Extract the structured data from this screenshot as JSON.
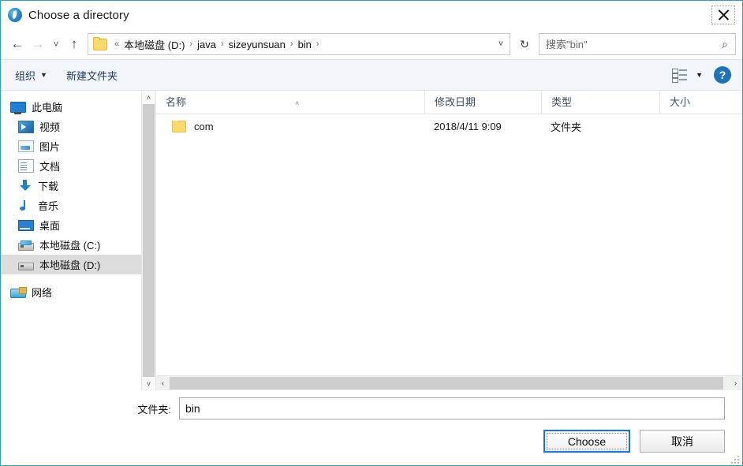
{
  "window": {
    "title": "Choose a directory",
    "title_icon": "app-globe-icon",
    "close_label": "✕",
    "border_color": "#2f9fc4"
  },
  "nav": {
    "back_icon": "←",
    "forward_icon": "→",
    "recent_icon": "˅",
    "up_icon": "↑",
    "refresh_icon": "↻",
    "dropdown_icon": "˅",
    "breadcrumb_prefix": "«",
    "breadcrumbs": [
      "本地磁盘 (D:)",
      "java",
      "sizeyunsuan",
      "bin"
    ],
    "separator": "›"
  },
  "search": {
    "placeholder": "搜索\"bin\"",
    "value": "",
    "icon": "⌕"
  },
  "toolbar": {
    "organize_label": "组织",
    "organize_caret": "▼",
    "new_folder_label": "新建文件夹",
    "view_caret": "▼",
    "help_label": "?"
  },
  "sidebar": {
    "items": [
      {
        "label": "此电脑",
        "icon": "this-pc-icon",
        "level": 0,
        "selected": false
      },
      {
        "label": "视频",
        "icon": "videos-icon",
        "level": 1,
        "selected": false
      },
      {
        "label": "图片",
        "icon": "pictures-icon",
        "level": 1,
        "selected": false
      },
      {
        "label": "文档",
        "icon": "documents-icon",
        "level": 1,
        "selected": false
      },
      {
        "label": "下载",
        "icon": "downloads-icon",
        "level": 1,
        "selected": false
      },
      {
        "label": "音乐",
        "icon": "music-icon",
        "level": 1,
        "selected": false
      },
      {
        "label": "桌面",
        "icon": "desktop-icon",
        "level": 1,
        "selected": false
      },
      {
        "label": "本地磁盘 (C:)",
        "icon": "system-drive-icon",
        "level": 1,
        "selected": false
      },
      {
        "label": "本地磁盘 (D:)",
        "icon": "drive-icon",
        "level": 1,
        "selected": true
      },
      {
        "label": "网络",
        "icon": "network-icon",
        "level": 0,
        "selected": false
      }
    ],
    "scroll_up_icon": "˄",
    "scroll_down_icon": "˅"
  },
  "filelist": {
    "columns": {
      "name": "名称",
      "date": "修改日期",
      "type": "类型",
      "size": "大小"
    },
    "sort_indicator": "˄",
    "rows": [
      {
        "name": "com",
        "date": "2018/4/11 9:09",
        "type": "文件夹",
        "size": "",
        "icon": "folder-icon"
      }
    ],
    "hscroll_left_icon": "‹",
    "hscroll_right_icon": "›"
  },
  "footer": {
    "folder_label": "文件夹:",
    "folder_value": "bin",
    "folder_placeholder": "",
    "choose_label": "Choose",
    "cancel_label": "取消"
  }
}
